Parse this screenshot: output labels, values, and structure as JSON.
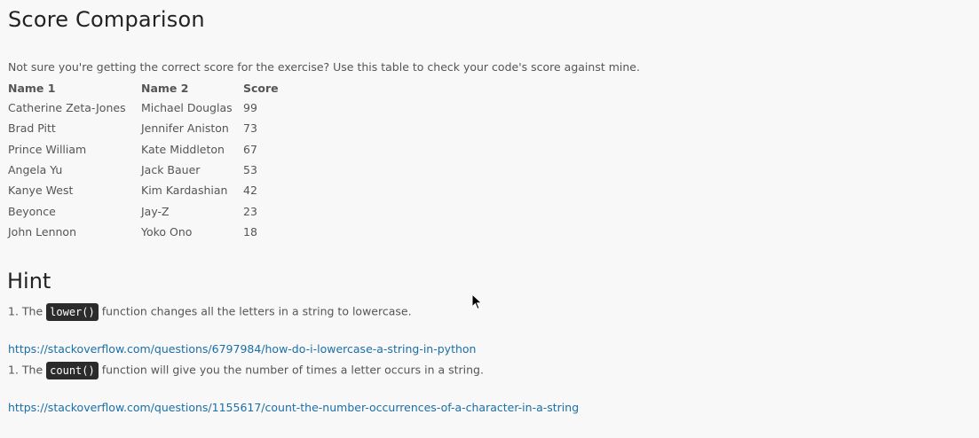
{
  "title": "Score Comparison",
  "intro": "Not sure you're getting the correct score for the exercise? Use this table to check your code's score against mine.",
  "table": {
    "headers": [
      "Name 1",
      "Name 2",
      "Score"
    ],
    "rows": [
      [
        "Catherine Zeta-Jones",
        "Michael Douglas",
        "99"
      ],
      [
        "Brad Pitt",
        "Jennifer Aniston",
        "73"
      ],
      [
        "Prince William",
        "Kate Middleton",
        "67"
      ],
      [
        "Angela Yu",
        "Jack Bauer",
        "53"
      ],
      [
        "Kanye West",
        "Kim Kardashian",
        "42"
      ],
      [
        "Beyonce",
        "Jay-Z",
        "23"
      ],
      [
        "John Lennon",
        "Yoko Ono",
        "18"
      ]
    ]
  },
  "hint": {
    "title": "Hint",
    "items": [
      {
        "prefix": "1. The",
        "code": "lower()",
        "suffix": "function changes all the letters in a string to lowercase.",
        "link": "https://stackoverflow.com/questions/6797984/how-do-i-lowercase-a-string-in-python"
      },
      {
        "prefix": "1. The",
        "code": "count()",
        "suffix": "function will give you the number of times a letter occurs in a string.",
        "link": "https://stackoverflow.com/questions/1155617/count-the-number-occurrences-of-a-character-in-a-string"
      }
    ]
  },
  "colors": {
    "link": "#1a6fa8",
    "code_bg": "#2b2b2b",
    "background": "#f8f8f8"
  },
  "icons": {
    "cursor": "mouse-pointer-icon"
  }
}
